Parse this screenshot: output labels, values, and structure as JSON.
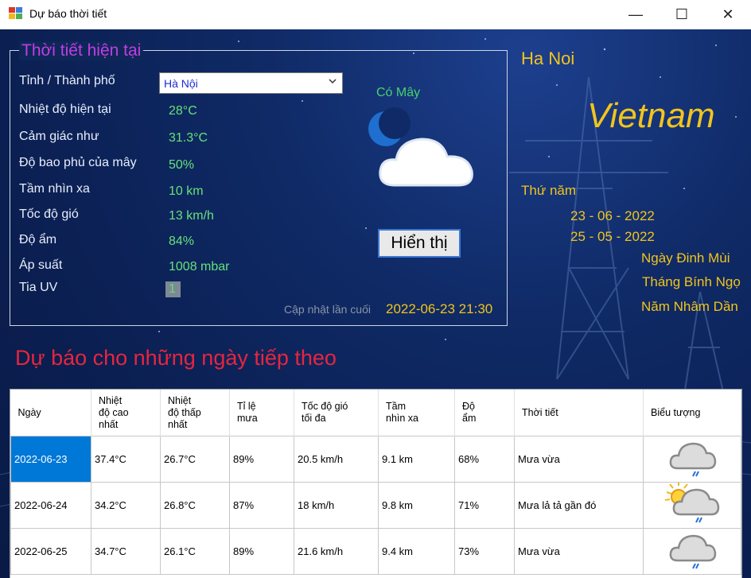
{
  "window": {
    "title": "Dự báo thời tiết",
    "controls": {
      "minimize": "—",
      "maximize": "☐",
      "close": "✕"
    }
  },
  "current": {
    "group_title": "Thời tiết hiện tại",
    "province_label": "Tỉnh / Thành phố",
    "province_value": "Hà Nội",
    "fields": [
      {
        "label": "Nhiệt độ hiện tại",
        "value": "28°C"
      },
      {
        "label": "Cảm giác như",
        "value": "31.3°C"
      },
      {
        "label": "Độ bao phủ của mây",
        "value": "50%"
      },
      {
        "label": "Tầm nhìn xa",
        "value": "10 km"
      },
      {
        "label": "Tốc độ gió",
        "value": "13 km/h"
      },
      {
        "label": "Độ ẩm",
        "value": "84%"
      },
      {
        "label": "Áp suất",
        "value": "1008 mbar"
      },
      {
        "label": "Tia UV",
        "value": "1"
      }
    ],
    "condition": "Có Mây",
    "condition_icon": "cloudy-night-icon",
    "show_button": "Hiển thị",
    "updated_label": "Cập nhật lần cuối",
    "updated_value": "2022-06-23 21:30"
  },
  "location": {
    "city": "Ha Noi",
    "country": "Vietnam",
    "weekday": "Thứ năm",
    "solar_date": "23 - 06 - 2022",
    "lunar_date": "25 - 05 - 2022",
    "lunar_day": "Ngày Đinh Mùi",
    "lunar_month": "Tháng Bính Ngọ",
    "lunar_year": "Năm Nhâm Dần"
  },
  "forecast": {
    "title": "Dự báo cho những ngày tiếp theo",
    "headers": [
      "Ngày",
      "Nhiệt\nđộ cao\nnhất",
      "Nhiệt\nđộ thấp\nnhất",
      "Tỉ lệ\nmưa",
      "Tốc độ gió\ntối đa",
      "Tầm\nnhìn xa",
      "Độ\nẩm",
      "Thời tiết",
      "Biểu tượng"
    ],
    "rows": [
      {
        "date": "2022-06-23",
        "max": "37.4°C",
        "min": "26.7°C",
        "rain": "89%",
        "wind": "20.5 km/h",
        "vis": "9.1 km",
        "hum": "68%",
        "desc": "Mưa vừa",
        "icon": "rain-cloud-icon"
      },
      {
        "date": "2022-06-24",
        "max": "34.2°C",
        "min": "26.8°C",
        "rain": "87%",
        "wind": "18 km/h",
        "vis": "9.8 km",
        "hum": "71%",
        "desc": "Mưa lả tả gần đó",
        "icon": "sun-rain-cloud-icon"
      },
      {
        "date": "2022-06-25",
        "max": "34.7°C",
        "min": "26.1°C",
        "rain": "89%",
        "wind": "21.6 km/h",
        "vis": "9.4 km",
        "hum": "73%",
        "desc": "Mưa vừa",
        "icon": "rain-cloud-icon"
      }
    ]
  },
  "colors": {
    "accent_yellow": "#f2c41c",
    "value_green": "#66e27a",
    "forecast_title": "#e8253e",
    "group_title": "#c23de3",
    "selection": "#0078d7"
  }
}
